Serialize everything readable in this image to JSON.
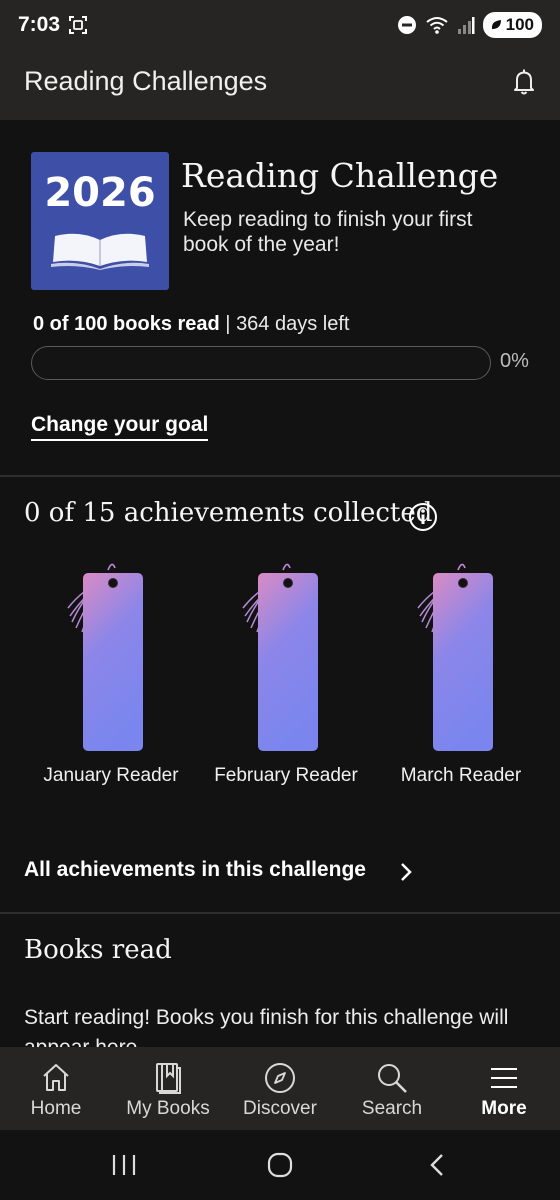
{
  "status_bar": {
    "time": "7:03",
    "battery": "100",
    "icons": [
      "screenshot-icon",
      "do-not-disturb-icon",
      "wifi-icon",
      "signal-icon",
      "battery-icon"
    ]
  },
  "app_bar": {
    "title": "Reading Challenges",
    "notifications_icon": "bell-icon"
  },
  "challenge": {
    "cover_year": "2026",
    "title": "Reading Challenge",
    "subtitle": "Keep reading to finish your first book of the year!",
    "books_read": "0 of 100 books read",
    "separator": " | ",
    "days_left": "364 days left",
    "progress_fraction": 0,
    "progress_percent_label": "0%",
    "change_goal_label": "Change your goal"
  },
  "achievements": {
    "heading": "0 of 15 achievements collected",
    "items": [
      {
        "label": "January Reader"
      },
      {
        "label": "February Reader"
      },
      {
        "label": "March Reader"
      }
    ],
    "all_link_label": "All achievements in this challenge"
  },
  "books_read": {
    "heading": "Books read",
    "empty_text": "Start reading! Books you finish for this challenge will appear here."
  },
  "bottom_nav": {
    "items": [
      {
        "label": "Home",
        "icon": "home-icon"
      },
      {
        "label": "My Books",
        "icon": "my-books-icon"
      },
      {
        "label": "Discover",
        "icon": "compass-icon"
      },
      {
        "label": "Search",
        "icon": "search-icon"
      },
      {
        "label": "More",
        "icon": "menu-icon",
        "active": true
      }
    ]
  },
  "colors": {
    "background": "#121212",
    "bar_background": "#262524",
    "cover_blue": "#3e4fa8",
    "bookmark_top": "#d98bc4",
    "bookmark_bottom": "#7f87ee"
  }
}
